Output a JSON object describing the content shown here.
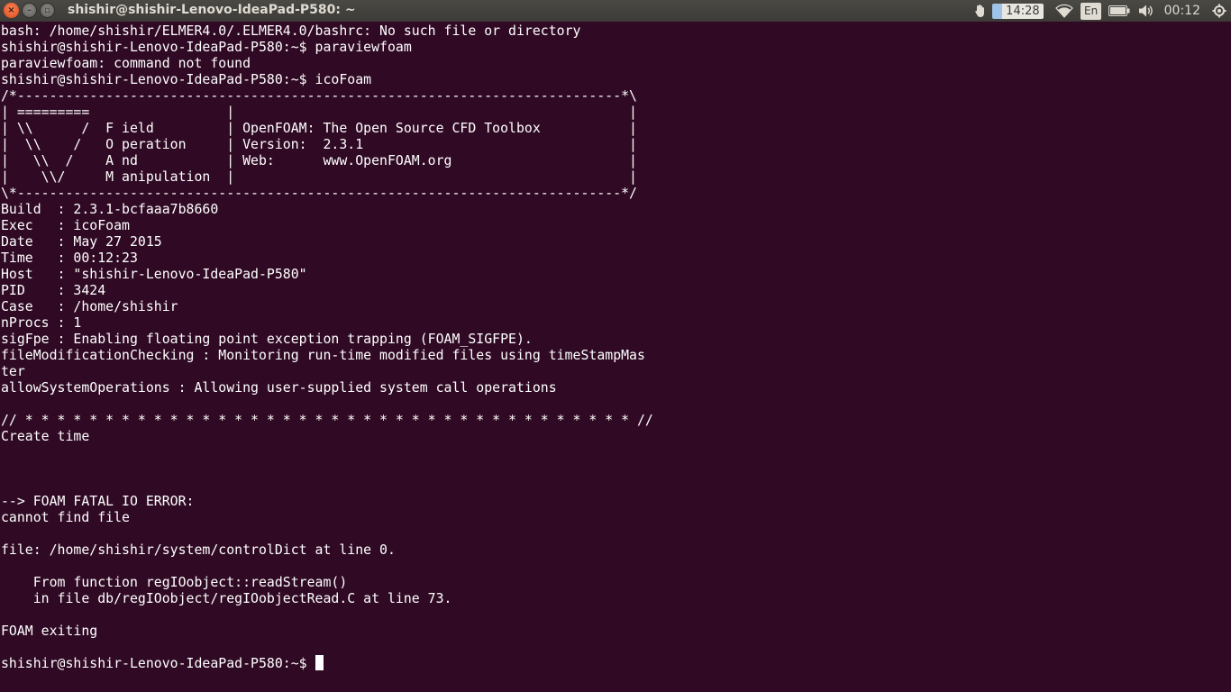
{
  "window": {
    "title": "shishir@shishir-Lenovo-IdeaPad-P580: ~",
    "close_glyph": "×",
    "minimize_glyph": "–",
    "maximize_glyph": "▫"
  },
  "indicators": {
    "badge_time": "14:28",
    "keyboard_layout": "En",
    "clock": "00:12",
    "icons": [
      "hand-icon",
      "wifi-icon",
      "keyboard-icon",
      "battery-icon",
      "volume-icon"
    ]
  },
  "terminal": {
    "lines": [
      "bash: /home/shishir/ELMER4.0/.ELMER4.0/bashrc: No such file or directory",
      "shishir@shishir-Lenovo-IdeaPad-P580:~$ paraviewfoam",
      "paraviewfoam: command not found",
      "shishir@shishir-Lenovo-IdeaPad-P580:~$ icoFoam",
      "/*---------------------------------------------------------------------------*\\",
      "| =========                 |                                                 |",
      "| \\\\      /  F ield         | OpenFOAM: The Open Source CFD Toolbox           |",
      "|  \\\\    /   O peration     | Version:  2.3.1                                 |",
      "|   \\\\  /    A nd           | Web:      www.OpenFOAM.org                      |",
      "|    \\\\/     M anipulation  |                                                 |",
      "\\*---------------------------------------------------------------------------*/",
      "Build  : 2.3.1-bcfaaa7b8660",
      "Exec   : icoFoam",
      "Date   : May 27 2015",
      "Time   : 00:12:23",
      "Host   : \"shishir-Lenovo-IdeaPad-P580\"",
      "PID    : 3424",
      "Case   : /home/shishir",
      "nProcs : 1",
      "sigFpe : Enabling floating point exception trapping (FOAM_SIGFPE).",
      "fileModificationChecking : Monitoring run-time modified files using timeStampMas",
      "ter",
      "allowSystemOperations : Allowing user-supplied system call operations",
      "",
      "// * * * * * * * * * * * * * * * * * * * * * * * * * * * * * * * * * * * * * * //",
      "Create time",
      "",
      "",
      "",
      "--> FOAM FATAL IO ERROR:",
      "cannot find file",
      "",
      "file: /home/shishir/system/controlDict at line 0.",
      "",
      "    From function regIOobject::readStream()",
      "    in file db/regIOobject/regIOobjectRead.C at line 73.",
      "",
      "FOAM exiting",
      ""
    ],
    "prompt": "shishir@shishir-Lenovo-IdeaPad-P580:~$ "
  }
}
